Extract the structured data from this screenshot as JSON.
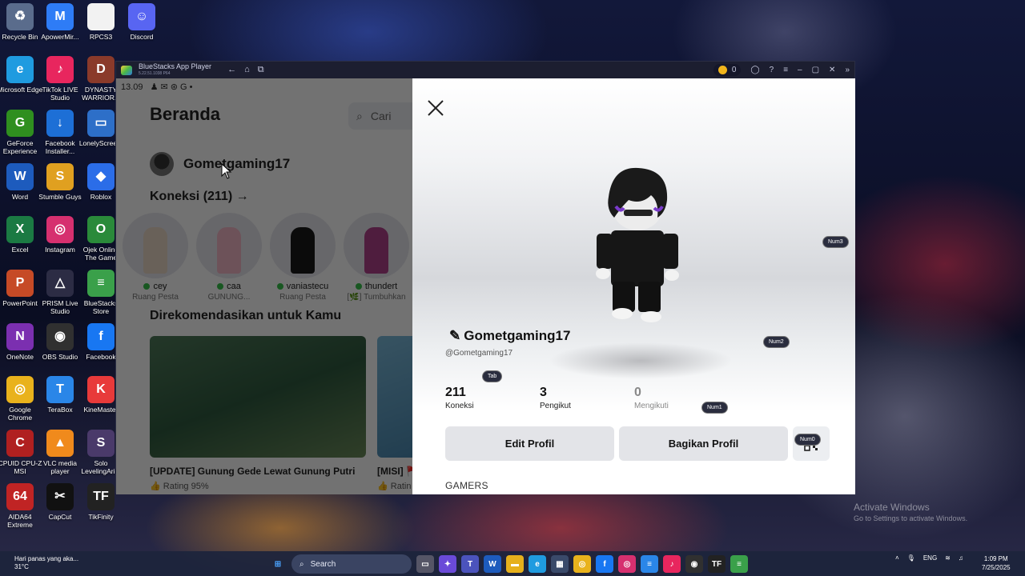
{
  "desktop": {
    "icons": [
      {
        "label": "Recycle Bin",
        "icon": "recycle-bin-icon",
        "color": "#5a6c8c",
        "glyph": "♻"
      },
      {
        "label": "ApowerMir...",
        "icon": "apowermirror-icon",
        "color": "#2e7cf6",
        "glyph": "M"
      },
      {
        "label": "RPCS3",
        "icon": "file-icon",
        "color": "#f2f2f2",
        "glyph": ""
      },
      {
        "label": "Discord",
        "icon": "discord-icon",
        "color": "#5865f2",
        "glyph": "☺"
      },
      {
        "label": "Microsoft Edge",
        "icon": "edge-icon",
        "color": "#1f9be0",
        "glyph": "e"
      },
      {
        "label": "TikTok LIVE Studio",
        "icon": "tiktok-icon",
        "color": "#e8265e",
        "glyph": "♪"
      },
      {
        "label": "DYNASTY WARRIOR...",
        "icon": "game-icon",
        "color": "#8a3a2a",
        "glyph": "D"
      },
      {
        "label": "GeForce Experience",
        "icon": "nvidia-icon",
        "color": "#2f8f1f",
        "glyph": "G"
      },
      {
        "label": "Facebook Installer...",
        "icon": "download-icon",
        "color": "#1d6fd6",
        "glyph": "↓"
      },
      {
        "label": "LonelyScree...",
        "icon": "monitor-icon",
        "color": "#2d6fc8",
        "glyph": "▭"
      },
      {
        "label": "Word",
        "icon": "word-icon",
        "color": "#1d5bbd",
        "glyph": "W"
      },
      {
        "label": "Stumble Guys",
        "icon": "stumble-guys-icon",
        "color": "#e0a020",
        "glyph": "S"
      },
      {
        "label": "Roblox",
        "icon": "roblox-icon",
        "color": "#2b6de8",
        "glyph": "◆"
      },
      {
        "label": "Excel",
        "icon": "excel-icon",
        "color": "#1b7a43",
        "glyph": "X"
      },
      {
        "label": "Instagram",
        "icon": "instagram-icon",
        "color": "#d6306f",
        "glyph": "◎"
      },
      {
        "label": "Ojek Online The Game",
        "icon": "game-icon",
        "color": "#2a8a3a",
        "glyph": "O"
      },
      {
        "label": "PowerPoint",
        "icon": "powerpoint-icon",
        "color": "#c64a26",
        "glyph": "P"
      },
      {
        "label": "PRISM Live Studio",
        "icon": "prism-icon",
        "color": "#2c2c44",
        "glyph": "△"
      },
      {
        "label": "BlueStacks Store",
        "icon": "bluestacks-icon",
        "color": "#3aa04a",
        "glyph": "≡"
      },
      {
        "label": "OneNote",
        "icon": "onenote-icon",
        "color": "#7b2fb0",
        "glyph": "N"
      },
      {
        "label": "OBS Studio",
        "icon": "obs-icon",
        "color": "#303030",
        "glyph": "◉"
      },
      {
        "label": "Facebook",
        "icon": "facebook-icon",
        "color": "#1877f2",
        "glyph": "f"
      },
      {
        "label": "Google Chrome",
        "icon": "chrome-icon",
        "color": "#e9b21c",
        "glyph": "◎"
      },
      {
        "label": "TeraBox",
        "icon": "terabox-icon",
        "color": "#2a86e8",
        "glyph": "T"
      },
      {
        "label": "KineMaster",
        "icon": "kinemaster-icon",
        "color": "#e83a3a",
        "glyph": "K"
      },
      {
        "label": "CPUID CPU-Z MSI",
        "icon": "cpuz-icon",
        "color": "#b02020",
        "glyph": "C"
      },
      {
        "label": "VLC media player",
        "icon": "vlc-icon",
        "color": "#f08a1c",
        "glyph": "▲"
      },
      {
        "label": "Solo LevelingAri...",
        "icon": "game-icon",
        "color": "#4a3a6a",
        "glyph": "S"
      },
      {
        "label": "AIDA64 Extreme",
        "icon": "aida64-icon",
        "color": "#c02424",
        "glyph": "64"
      },
      {
        "label": "CapCut",
        "icon": "capcut-icon",
        "color": "#111111",
        "glyph": "✂"
      },
      {
        "label": "TikFinity",
        "icon": "tikfinity-icon",
        "color": "#222222",
        "glyph": "TF"
      }
    ],
    "watermark_title": "Activate Windows",
    "watermark_sub": "Go to Settings to activate Windows."
  },
  "bluestacks": {
    "title": "BlueStacks App Player",
    "version": "5.22.51.1038  P64",
    "coins": "0",
    "accent": "#f1b51c"
  },
  "android": {
    "status_time": "13.09",
    "home_title": "Beranda",
    "search_placeholder": "Cari",
    "username": "Gometgaming17",
    "connections_heading": "Koneksi (211) →",
    "friends": [
      {
        "name": "cey",
        "status": "Ruang Pesta",
        "color": "#e9d7c6"
      },
      {
        "name": "caa",
        "status": "GUNUNG...",
        "color": "#f2b7c5"
      },
      {
        "name": "vaniastecu",
        "status": "Ruang Pesta",
        "color": "#1a1a1a"
      },
      {
        "name": "thundert",
        "status": "[🌿] Tumbuhkan",
        "color": "#b0428a"
      }
    ],
    "recommended_heading": "Direkomendasikan untuk Kamu",
    "games": [
      {
        "title": "[UPDATE] Gunung Gede Lewat Gunung Putri",
        "rating": "👍 Rating 95%"
      },
      {
        "title": "[MISI] 🚩",
        "rating": "👍 Ratin"
      }
    ]
  },
  "profile": {
    "display_name": "Gometgaming17",
    "handle": "@Gometgaming17",
    "stats": [
      {
        "value": "211",
        "label": "Koneksi"
      },
      {
        "value": "3",
        "label": "Pengikut"
      },
      {
        "value": "0",
        "label": "Mengikuti"
      }
    ],
    "edit_button": "Edit Profil",
    "share_button": "Bagikan Profil",
    "section_label": "GAMERS",
    "key_hints": {
      "tab": "Tab",
      "num3": "Num3",
      "num2": "Num2",
      "num1": "Num1",
      "num0": "Num0"
    }
  },
  "taskbar": {
    "weather_line1": "Hari panas yang aka...",
    "weather_line2": "31°C",
    "search_label": "Search",
    "language": "ENG",
    "time": "1:09 PM",
    "date": "7/25/2025"
  }
}
